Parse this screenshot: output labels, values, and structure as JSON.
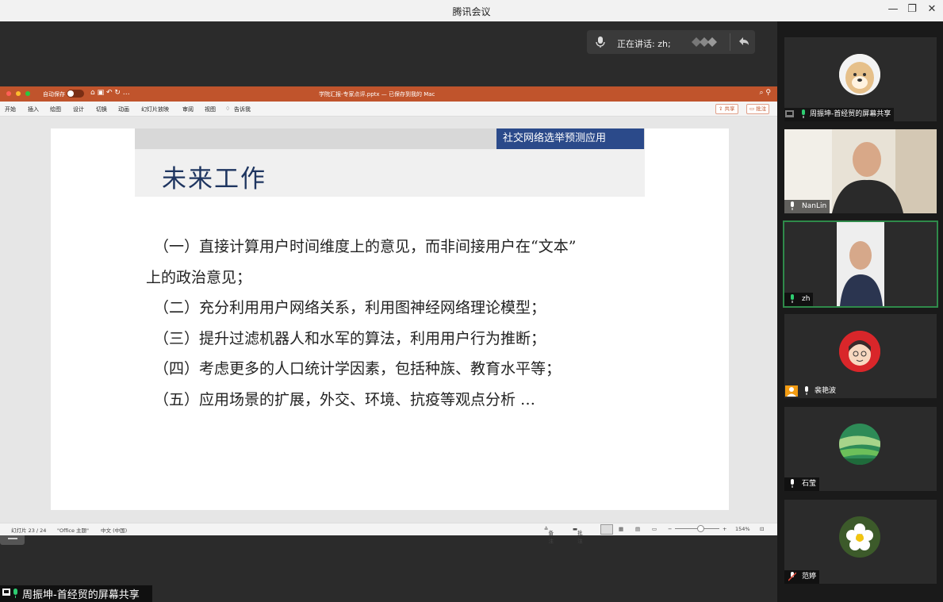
{
  "app": {
    "title": "腾讯会议"
  },
  "speaking": {
    "label": "正在讲话: zh;"
  },
  "ppt": {
    "autosave_label": "自动保存",
    "toggle_label": "关闭",
    "document_title": "学院汇报-专家点评.pptx — 已保存到我的 Mac",
    "ribbon_tabs": [
      "开始",
      "插入",
      "绘图",
      "设计",
      "切换",
      "动画",
      "幻灯片放映",
      "审阅",
      "视图",
      "告诉我"
    ],
    "share_button": "共享",
    "comment_button": "批注",
    "status": {
      "slide": "幻灯片 23 / 24",
      "theme": "\"Office 主题\"",
      "language": "中文 (中国)",
      "notes": "备注",
      "comments": "批注",
      "zoom": "154%"
    }
  },
  "slide": {
    "tag": "社交网络选举预测应用",
    "title": "未来工作",
    "items": [
      "（一）直接计算用户时间维度上的意见，而非间接用户在“文本”",
      "上的政治意见；",
      "（二）充分利用用户网络关系，利用图神经网络理论模型；",
      "（三）提升过滤机器人和水军的算法，利用用户行为推断；",
      "（四）考虑更多的人口统计学因素，包括种族、教育水平等；",
      "（五）应用场景的扩展，外交、环境、抗疫等观点分析 …"
    ]
  },
  "screen_share_label": "周振坤-首经贸的屏幕共享",
  "participants": [
    {
      "name": "周振坤-首经贸的屏幕共享",
      "avatar": "dog-avatar"
    },
    {
      "name": "NanLin",
      "avatar": "video"
    },
    {
      "name": "zh",
      "avatar": "video"
    },
    {
      "name": "裴艳波",
      "avatar": "cartoon-avatar"
    },
    {
      "name": "石莹",
      "avatar": "landscape-avatar"
    },
    {
      "name": "范婷",
      "avatar": "flower-avatar"
    }
  ],
  "colors": {
    "ppt_accent": "#c0542c",
    "slide_tag_bg": "#2b4a8a",
    "slide_title": "#1e3560",
    "active_border": "#2f8a4a"
  }
}
